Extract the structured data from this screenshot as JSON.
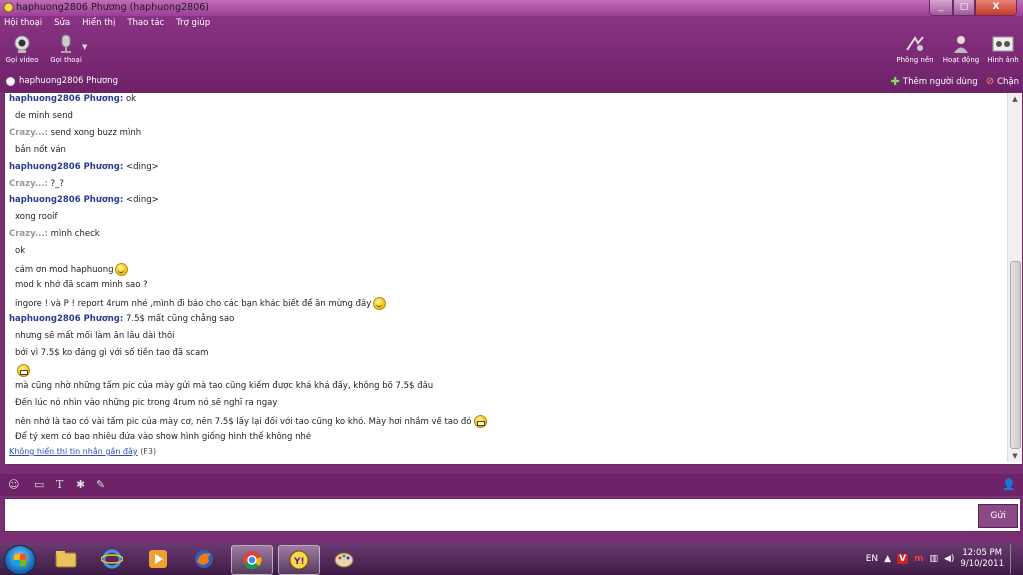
{
  "window": {
    "title": "haphuong2806 Phương (haphuong2806)",
    "minimize": "_",
    "maximize": "▢",
    "close": "X"
  },
  "menu": [
    "Hội thoại",
    "Sửa",
    "Hiển thị",
    "Thao tác",
    "Trợ giúp"
  ],
  "toolbar_left": [
    {
      "label": "Gọi video",
      "icon": "webcam-icon"
    },
    {
      "label": "Gọi thoại",
      "icon": "microphone-icon"
    }
  ],
  "toolbar_right": [
    {
      "label": "Phông nền",
      "icon": "background-icon"
    },
    {
      "label": "Hoạt động",
      "icon": "activity-icon"
    },
    {
      "label": "Hình ảnh",
      "icon": "photos-icon"
    }
  ],
  "contact": {
    "name": "haphuong2806 Phương"
  },
  "actions": {
    "add_user": "Thêm người dùng",
    "block": "Chặn"
  },
  "conversation": [
    {
      "type": "sender",
      "sender": "haphuong2806 Phương:",
      "who": "me",
      "text": " ok"
    },
    {
      "type": "body",
      "text": "de minh send"
    },
    {
      "type": "sender",
      "sender": "Crazy...:",
      "who": "other",
      "text": " send xong buzz mình"
    },
    {
      "type": "body",
      "text": "bắn nốt ván"
    },
    {
      "type": "sender",
      "sender": "haphuong2806 Phương:",
      "who": "me",
      "text": " <ding>"
    },
    {
      "type": "sender",
      "sender": "Crazy...:",
      "who": "other",
      "text": " ?_?"
    },
    {
      "type": "sender",
      "sender": "haphuong2806 Phương:",
      "who": "me",
      "text": " <ding>"
    },
    {
      "type": "body",
      "text": "xong rooif"
    },
    {
      "type": "sender",
      "sender": "Crazy...:",
      "who": "other",
      "text": " mình check"
    },
    {
      "type": "body",
      "text": "ok"
    },
    {
      "type": "body",
      "text": "cám ơn mod haphuong",
      "emoticon": "smile"
    },
    {
      "type": "body",
      "text": "mod k nhớ đã scam mình sao ?"
    },
    {
      "type": "body",
      "text": "ingore ! và P ! report 4rum nhé ,mình đi báo cho các bạn khác biết để ăn mừng đây",
      "emoticon": "smile"
    },
    {
      "type": "sender",
      "sender": "haphuong2806 Phương:",
      "who": "me",
      "text": " 7.5$ mất cũng chẳng sao"
    },
    {
      "type": "body",
      "text": "nhưng sẽ mất mối làm ăn lâu dài thôi"
    },
    {
      "type": "body",
      "text": "bởi vì 7.5$ ko đáng gì với số tiền tao đã scam"
    },
    {
      "type": "body",
      "text": "",
      "emoticon": "grin"
    },
    {
      "type": "body",
      "text": "mà cũng nhờ những tấm pic của mày gửi mà tao cũng kiếm được khá khá đấy, không bõ 7.5$ đâu"
    },
    {
      "type": "body",
      "text": "Đến lúc nó nhìn vào những pic trong 4rum nó sẽ nghĩ ra ngay"
    },
    {
      "type": "body",
      "text": "nên nhớ là tao có vài tấm pic của mày cơ, nên 7.5$ lấy lại đối với tao cũng ko khó. Mày hơi nhầm về tao đó",
      "emoticon": "grin"
    },
    {
      "type": "body",
      "text": "Để tý xem có bao nhiêu đứa vào show hình giống hình thế không nhé"
    }
  ],
  "recent": {
    "link": "Không hiển thị tin nhắn gần đây",
    "shortcut": "(F3)"
  },
  "input": {
    "value": "",
    "placeholder": ""
  },
  "send_label": "Gửi",
  "taskbar": {
    "apps": [
      "explorer-icon",
      "internet-explorer-icon",
      "media-player-icon",
      "firefox-icon",
      "chrome-icon",
      "yahoo-messenger-icon",
      "paint-icon"
    ],
    "lang": "EN",
    "time": "12:05 PM",
    "date": "9/10/2011"
  },
  "colors": {
    "chrome": "#7a2e74",
    "accent": "#8a3384",
    "sender_me": "#2a3d8f",
    "sender_other": "#999999"
  }
}
